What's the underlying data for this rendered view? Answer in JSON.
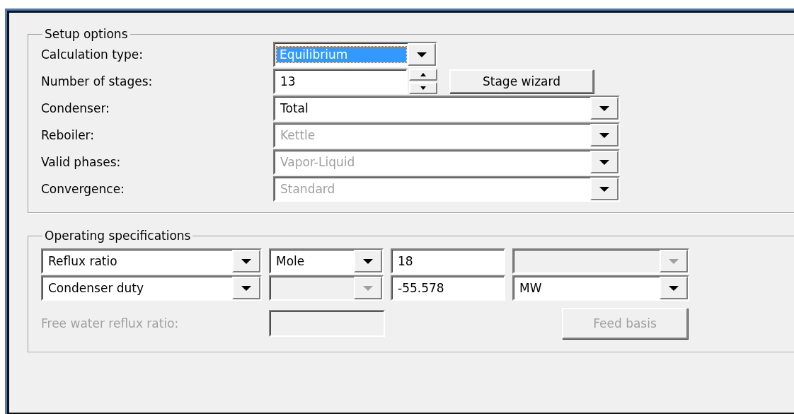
{
  "setup_options": {
    "title": "Setup options",
    "fields": [
      {
        "label": "Calculation type:",
        "kind": "short_dropdown",
        "value": "Equilibrium",
        "disabled": false,
        "focused": true
      },
      {
        "label": "Number of stages:",
        "kind": "spinner",
        "value": "13",
        "button": "Stage wizard",
        "disabled": false,
        "focused": false
      },
      {
        "label": "Condenser:",
        "kind": "dropdown",
        "value": "Total",
        "disabled": false,
        "focused": false
      },
      {
        "label": "Reboiler:",
        "kind": "dropdown",
        "value": "Kettle",
        "disabled": true,
        "focused": false
      },
      {
        "label": "Valid phases:",
        "kind": "dropdown",
        "value": "Vapor-Liquid",
        "disabled": true,
        "focused": false
      },
      {
        "label": "Convergence:",
        "kind": "dropdown",
        "value": "Standard",
        "disabled": true,
        "focused": false
      }
    ]
  },
  "operating_specifications": {
    "title": "Operating specifications",
    "rows": [
      [
        {
          "kind": "spec_dropdown",
          "value": "Reflux ratio",
          "disabled": false
        },
        {
          "kind": "basis_dropdown",
          "value": "Mole",
          "disabled": false
        },
        {
          "kind": "value_field",
          "value": "18",
          "disabled": false
        },
        {
          "kind": "units_dropdown",
          "disabled": true
        }
      ],
      [
        {
          "kind": "spec_dropdown",
          "value": "Condenser duty",
          "disabled": false
        },
        {
          "kind": "basis_dropdown",
          "disabled": true
        },
        {
          "kind": "value_field",
          "value": "-55.578",
          "disabled": false
        },
        {
          "kind": "units_dropdown",
          "value": "MW",
          "disabled": false
        }
      ]
    ],
    "free_water": {
      "label": "Free water reflux ratio:",
      "disabled": true
    },
    "feed_basis": {
      "label": "Feed basis",
      "disabled": true
    }
  }
}
